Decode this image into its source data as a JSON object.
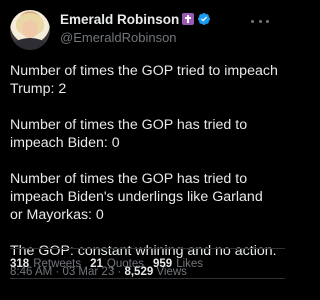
{
  "author": {
    "display_name": "Emerald Robinson",
    "handle": "@EmeraldRobinson",
    "badge_color": "#9b59b6",
    "verified_color": "#1d9bf0"
  },
  "tweet": {
    "paragraphs": [
      "Number of times the GOP tried to impeach Trump: 2",
      "Number of times the GOP has tried to impeach Biden: 0",
      "Number of times the GOP has tried to impeach Biden's underlings like Garland or Mayorkas: 0",
      "The GOP: constant whining and no action."
    ],
    "time": "8:46 AM",
    "date": "03 Mar 23",
    "separator": "·",
    "views_count": "8,529",
    "views_label": "Views"
  },
  "stats": {
    "retweets_count": "318",
    "retweets_label": "Retweets",
    "quotes_count": "21",
    "quotes_label": "Quotes",
    "likes_count": "959",
    "likes_label": "Likes"
  },
  "colors": {
    "background": "#000000",
    "text": "#e7e9ea",
    "muted": "#71767b",
    "divider": "#2f3336"
  }
}
